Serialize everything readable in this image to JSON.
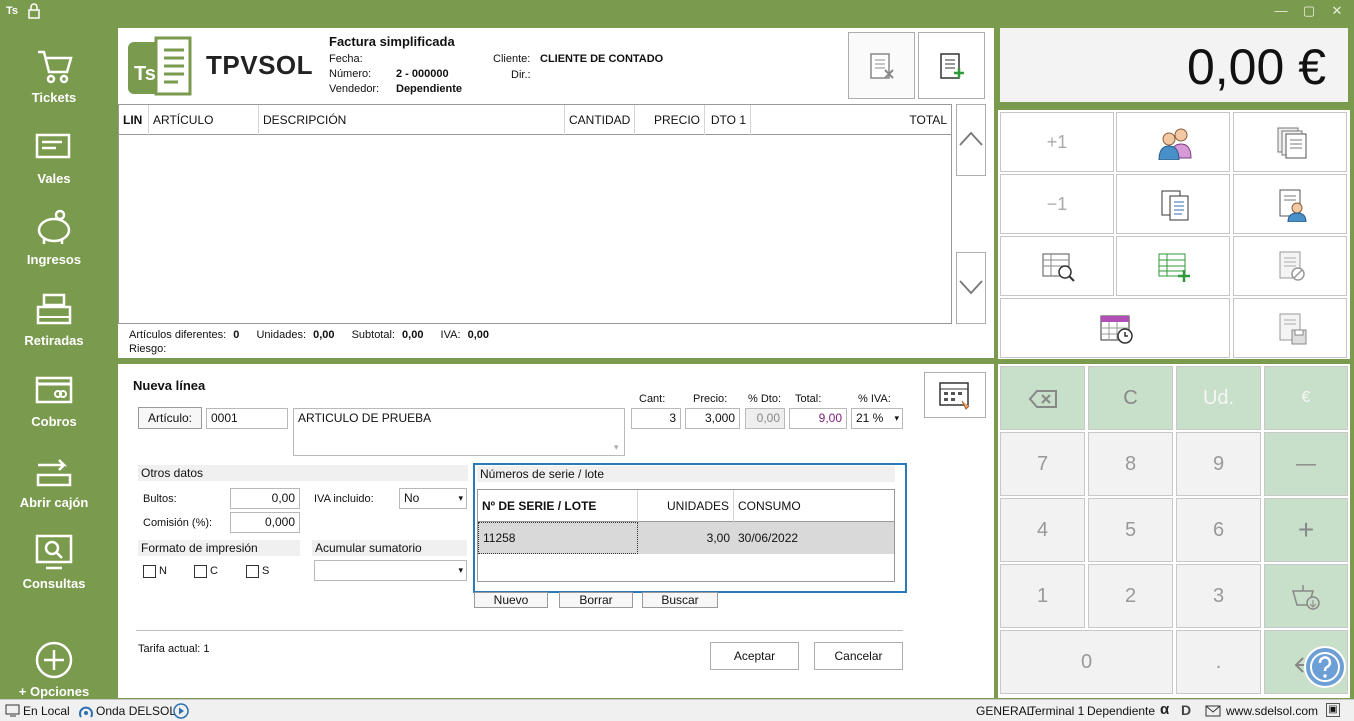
{
  "titlebar": {
    "logo": "Ts"
  },
  "sidebar": {
    "items": [
      {
        "label": "Tickets"
      },
      {
        "label": "Vales"
      },
      {
        "label": "Ingresos"
      },
      {
        "label": "Retiradas"
      },
      {
        "label": "Cobros"
      },
      {
        "label": "Abrir cajón"
      },
      {
        "label": "Consultas"
      },
      {
        "label": "+ Opciones"
      }
    ]
  },
  "header": {
    "brand": "TPVSOL",
    "brand_icon": "Ts",
    "doc_type": "Factura simplificada",
    "fecha_label": "Fecha:",
    "fecha_value": "",
    "numero_label": "Número:",
    "numero_value": "2 - 000000",
    "vendedor_label": "Vendedor:",
    "vendedor_value": "Dependiente",
    "cliente_label": "Cliente:",
    "cliente_value": "CLIENTE DE CONTADO",
    "dir_label": "Dir.:"
  },
  "lines_table": {
    "columns": [
      "LIN",
      "ARTÍCULO",
      "DESCRIPCIÓN",
      "CANTIDAD",
      "PRECIO",
      "DTO 1",
      "TOTAL"
    ]
  },
  "totals": {
    "articulos_label": "Artículos diferentes:",
    "articulos_value": "0",
    "unidades_label": "Unidades:",
    "unidades_value": "0,00",
    "subtotal_label": "Subtotal:",
    "subtotal_value": "0,00",
    "iva_label": "IVA:",
    "iva_value": "0,00",
    "riesgo_label": "Riesgo:"
  },
  "display": {
    "total": "0,00 €"
  },
  "new_line": {
    "title": "Nueva línea",
    "articulo_btn": "Artículo:",
    "articulo_code": "0001",
    "descripcion": "ARTICULO DE PRUEBA",
    "cant_label": "Cant:",
    "cant_value": "3",
    "precio_label": "Precio:",
    "precio_value": "3,000",
    "dto_label": "% Dto:",
    "dto_value": "0,00",
    "total_label": "Total:",
    "total_value": "9,00",
    "iva_label": "% IVA:",
    "iva_value": "21 %"
  },
  "otros": {
    "title": "Otros datos",
    "bultos_label": "Bultos:",
    "bultos_value": "0,00",
    "comision_label": "Comisión (%):",
    "comision_value": "0,000",
    "iva_incl_label": "IVA incluido:",
    "iva_incl_value": "No",
    "formato_title": "Formato de impresión",
    "fmt_n": "N",
    "fmt_c": "C",
    "fmt_s": "S",
    "acumular_title": "Acumular sumatorio",
    "acumular_value": ""
  },
  "serie": {
    "title": "Números de serie / lote",
    "columns": [
      "Nº DE SERIE / LOTE",
      "UNIDADES",
      "CONSUMO"
    ],
    "rows": [
      {
        "serie": "11258",
        "unidades": "3,00",
        "consumo": "30/06/2022"
      }
    ],
    "nuevo": "Nuevo",
    "borrar": "Borrar",
    "buscar": "Buscar"
  },
  "footer": {
    "tarifa": "Tarifa actual: 1",
    "aceptar": "Aceptar",
    "cancelar": "Cancelar"
  },
  "keypad": {
    "plus_one": "+1",
    "minus_one": "−1",
    "backspace": "⌫",
    "c": "C",
    "ud": "Ud.",
    "euro": "€",
    "k7": "7",
    "k8": "8",
    "k9": "9",
    "minus": "—",
    "k4": "4",
    "k5": "5",
    "k6": "6",
    "plus": "+",
    "k1": "1",
    "k2": "2",
    "k3": "3",
    "k0": "0",
    "dot": "."
  },
  "status": {
    "local": "En Local",
    "onda": "Onda DELSOL",
    "general": "GENERAL",
    "terminal": "Terminal 1",
    "dependiente": "Dependiente",
    "web": "www.sdelsol.com"
  }
}
